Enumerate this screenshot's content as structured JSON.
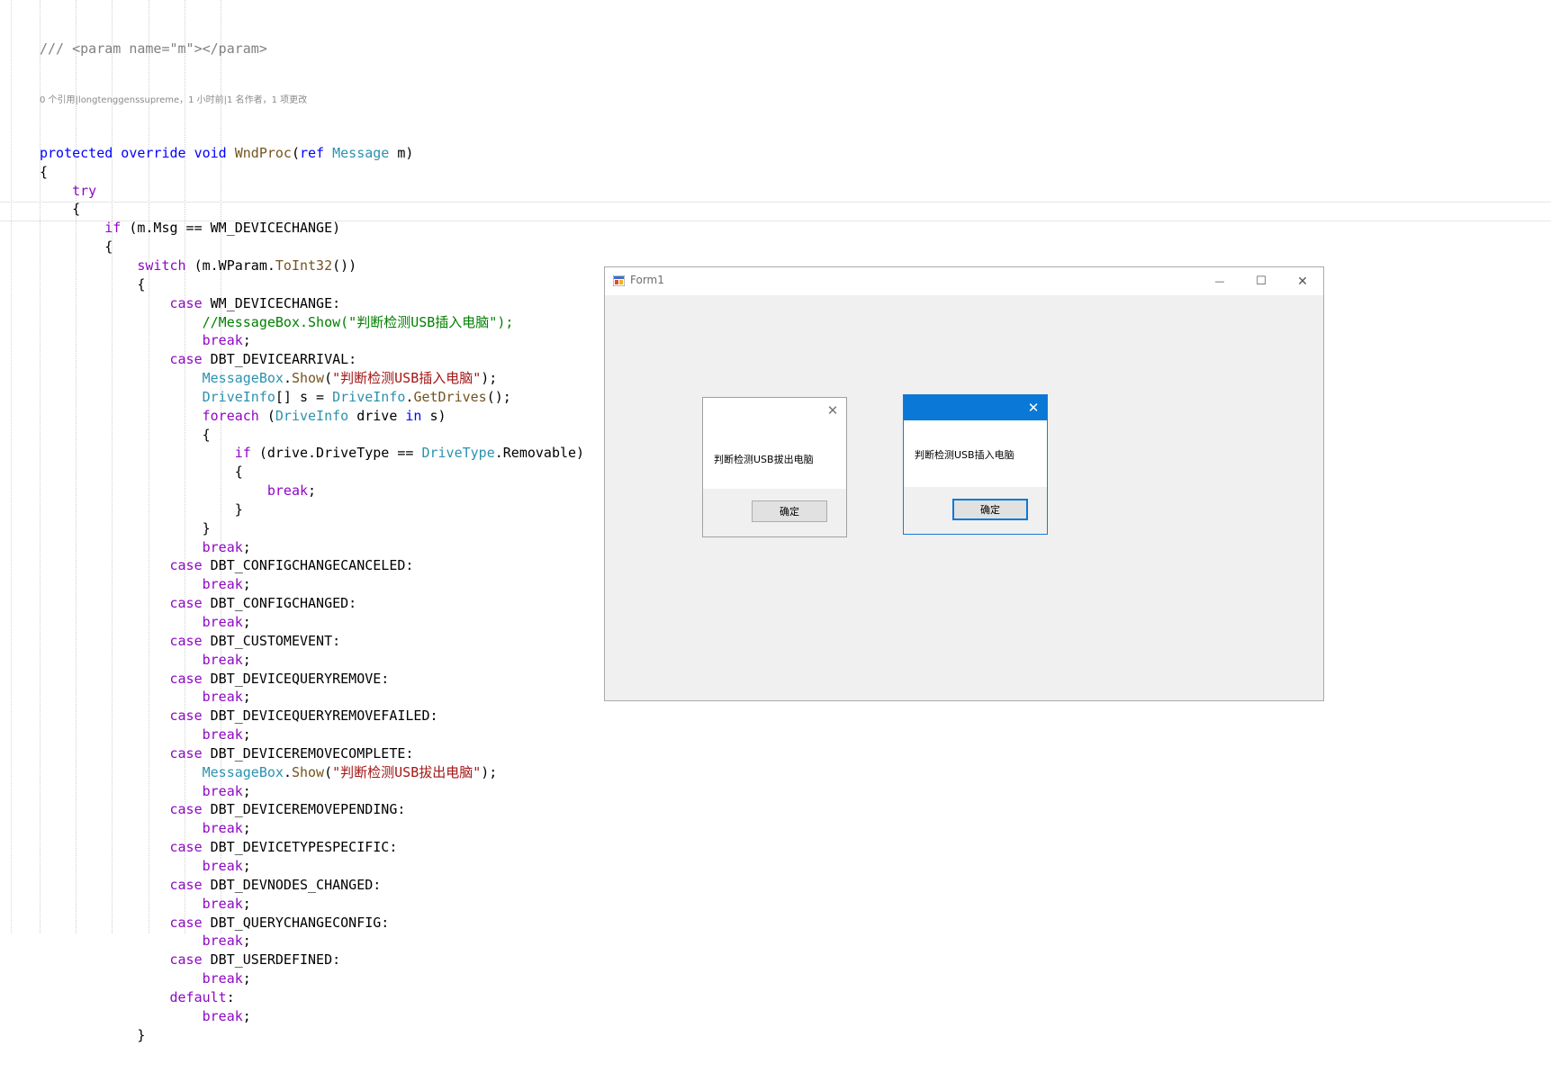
{
  "editor": {
    "codelens": "0 个引用|longtenggenssupreme，1 小时前|1 名作者，1 项更改",
    "lines": [
      [
        {
          "t": "/// <param name=\"m\"></param>",
          "c": "doc"
        }
      ],
      [
        {
          "t": "protected override void ",
          "c": "kw"
        },
        {
          "t": "WndProc",
          "c": "mt"
        },
        {
          "t": "(",
          "c": ""
        },
        {
          "t": "ref ",
          "c": "kw"
        },
        {
          "t": "Message",
          "c": "ty"
        },
        {
          "t": " m)",
          "c": ""
        }
      ],
      [
        {
          "t": "{",
          "c": ""
        }
      ],
      [
        {
          "t": "    ",
          "c": ""
        },
        {
          "t": "try",
          "c": "kwp"
        }
      ],
      [
        {
          "t": "    {",
          "c": ""
        }
      ],
      [
        {
          "t": "        ",
          "c": ""
        },
        {
          "t": "if",
          "c": "kwp"
        },
        {
          "t": " (m.Msg == WM_DEVICECHANGE)",
          "c": ""
        }
      ],
      [
        {
          "t": "        {",
          "c": ""
        }
      ],
      [
        {
          "t": "            ",
          "c": ""
        },
        {
          "t": "switch",
          "c": "kwp"
        },
        {
          "t": " (m.WParam.",
          "c": ""
        },
        {
          "t": "ToInt32",
          "c": "mt"
        },
        {
          "t": "())",
          "c": ""
        }
      ],
      [
        {
          "t": "            {",
          "c": ""
        }
      ],
      [
        {
          "t": "                ",
          "c": ""
        },
        {
          "t": "case",
          "c": "kwp"
        },
        {
          "t": " WM_DEVICECHANGE:",
          "c": ""
        }
      ],
      [
        {
          "t": "                    ",
          "c": ""
        },
        {
          "t": "//MessageBox.Show(\"判断检测USB插入电脑\");",
          "c": "cm"
        }
      ],
      [
        {
          "t": "                    ",
          "c": ""
        },
        {
          "t": "break",
          "c": "kwp"
        },
        {
          "t": ";",
          "c": ""
        }
      ],
      [
        {
          "t": "                ",
          "c": ""
        },
        {
          "t": "case",
          "c": "kwp"
        },
        {
          "t": " DBT_DEVICEARRIVAL:",
          "c": ""
        }
      ],
      [
        {
          "t": "                    ",
          "c": ""
        },
        {
          "t": "MessageBox",
          "c": "ty"
        },
        {
          "t": ".",
          "c": ""
        },
        {
          "t": "Show",
          "c": "mt"
        },
        {
          "t": "(",
          "c": ""
        },
        {
          "t": "\"判断检测USB插入电脑\"",
          "c": "str"
        },
        {
          "t": ");",
          "c": ""
        }
      ],
      [
        {
          "t": "                    ",
          "c": ""
        },
        {
          "t": "DriveInfo",
          "c": "ty"
        },
        {
          "t": "[] s = ",
          "c": ""
        },
        {
          "t": "DriveInfo",
          "c": "ty"
        },
        {
          "t": ".",
          "c": ""
        },
        {
          "t": "GetDrives",
          "c": "mt"
        },
        {
          "t": "();",
          "c": ""
        }
      ],
      [
        {
          "t": "                    ",
          "c": ""
        },
        {
          "t": "foreach",
          "c": "kwp"
        },
        {
          "t": " (",
          "c": ""
        },
        {
          "t": "DriveInfo",
          "c": "ty"
        },
        {
          "t": " drive ",
          "c": ""
        },
        {
          "t": "in",
          "c": "kw"
        },
        {
          "t": " s)",
          "c": ""
        }
      ],
      [
        {
          "t": "                    {",
          "c": ""
        }
      ],
      [
        {
          "t": "                        ",
          "c": ""
        },
        {
          "t": "if",
          "c": "kwp"
        },
        {
          "t": " (drive.DriveType == ",
          "c": ""
        },
        {
          "t": "DriveType",
          "c": "ty"
        },
        {
          "t": ".Removable)",
          "c": ""
        }
      ],
      [
        {
          "t": "                        {",
          "c": ""
        }
      ],
      [
        {
          "t": "                            ",
          "c": ""
        },
        {
          "t": "break",
          "c": "kwp"
        },
        {
          "t": ";",
          "c": ""
        }
      ],
      [
        {
          "t": "                        }",
          "c": ""
        }
      ],
      [
        {
          "t": "                    }",
          "c": ""
        }
      ],
      [
        {
          "t": "                    ",
          "c": ""
        },
        {
          "t": "break",
          "c": "kwp"
        },
        {
          "t": ";",
          "c": ""
        }
      ],
      [
        {
          "t": "                ",
          "c": ""
        },
        {
          "t": "case",
          "c": "kwp"
        },
        {
          "t": " DBT_CONFIGCHANGECANCELED:",
          "c": ""
        }
      ],
      [
        {
          "t": "                    ",
          "c": ""
        },
        {
          "t": "break",
          "c": "kwp"
        },
        {
          "t": ";",
          "c": ""
        }
      ],
      [
        {
          "t": "                ",
          "c": ""
        },
        {
          "t": "case",
          "c": "kwp"
        },
        {
          "t": " DBT_CONFIGCHANGED:",
          "c": ""
        }
      ],
      [
        {
          "t": "                    ",
          "c": ""
        },
        {
          "t": "break",
          "c": "kwp"
        },
        {
          "t": ";",
          "c": ""
        }
      ],
      [
        {
          "t": "                ",
          "c": ""
        },
        {
          "t": "case",
          "c": "kwp"
        },
        {
          "t": " DBT_CUSTOMEVENT:",
          "c": ""
        }
      ],
      [
        {
          "t": "                    ",
          "c": ""
        },
        {
          "t": "break",
          "c": "kwp"
        },
        {
          "t": ";",
          "c": ""
        }
      ],
      [
        {
          "t": "                ",
          "c": ""
        },
        {
          "t": "case",
          "c": "kwp"
        },
        {
          "t": " DBT_DEVICEQUERYREMOVE:",
          "c": ""
        }
      ],
      [
        {
          "t": "                    ",
          "c": ""
        },
        {
          "t": "break",
          "c": "kwp"
        },
        {
          "t": ";",
          "c": ""
        }
      ],
      [
        {
          "t": "                ",
          "c": ""
        },
        {
          "t": "case",
          "c": "kwp"
        },
        {
          "t": " DBT_DEVICEQUERYREMOVEFAILED:",
          "c": ""
        }
      ],
      [
        {
          "t": "                    ",
          "c": ""
        },
        {
          "t": "break",
          "c": "kwp"
        },
        {
          "t": ";",
          "c": ""
        }
      ],
      [
        {
          "t": "                ",
          "c": ""
        },
        {
          "t": "case",
          "c": "kwp"
        },
        {
          "t": " DBT_DEVICEREMOVECOMPLETE:",
          "c": ""
        }
      ],
      [
        {
          "t": "                    ",
          "c": ""
        },
        {
          "t": "MessageBox",
          "c": "ty"
        },
        {
          "t": ".",
          "c": ""
        },
        {
          "t": "Show",
          "c": "mt"
        },
        {
          "t": "(",
          "c": ""
        },
        {
          "t": "\"判断检测USB拔出电脑\"",
          "c": "str"
        },
        {
          "t": ");",
          "c": ""
        }
      ],
      [
        {
          "t": "                    ",
          "c": ""
        },
        {
          "t": "break",
          "c": "kwp"
        },
        {
          "t": ";",
          "c": ""
        }
      ],
      [
        {
          "t": "                ",
          "c": ""
        },
        {
          "t": "case",
          "c": "kwp"
        },
        {
          "t": " DBT_DEVICEREMOVEPENDING:",
          "c": ""
        }
      ],
      [
        {
          "t": "                    ",
          "c": ""
        },
        {
          "t": "break",
          "c": "kwp"
        },
        {
          "t": ";",
          "c": ""
        }
      ],
      [
        {
          "t": "                ",
          "c": ""
        },
        {
          "t": "case",
          "c": "kwp"
        },
        {
          "t": " DBT_DEVICETYPESPECIFIC:",
          "c": ""
        }
      ],
      [
        {
          "t": "                    ",
          "c": ""
        },
        {
          "t": "break",
          "c": "kwp"
        },
        {
          "t": ";",
          "c": ""
        }
      ],
      [
        {
          "t": "                ",
          "c": ""
        },
        {
          "t": "case",
          "c": "kwp"
        },
        {
          "t": " DBT_DEVNODES_CHANGED:",
          "c": ""
        }
      ],
      [
        {
          "t": "                    ",
          "c": ""
        },
        {
          "t": "break",
          "c": "kwp"
        },
        {
          "t": ";",
          "c": ""
        }
      ],
      [
        {
          "t": "                ",
          "c": ""
        },
        {
          "t": "case",
          "c": "kwp"
        },
        {
          "t": " DBT_QUERYCHANGECONFIG:",
          "c": ""
        }
      ],
      [
        {
          "t": "                    ",
          "c": ""
        },
        {
          "t": "break",
          "c": "kwp"
        },
        {
          "t": ";",
          "c": ""
        }
      ],
      [
        {
          "t": "                ",
          "c": ""
        },
        {
          "t": "case",
          "c": "kwp"
        },
        {
          "t": " DBT_USERDEFINED:",
          "c": ""
        }
      ],
      [
        {
          "t": "                    ",
          "c": ""
        },
        {
          "t": "break",
          "c": "kwp"
        },
        {
          "t": ";",
          "c": ""
        }
      ],
      [
        {
          "t": "                ",
          "c": ""
        },
        {
          "t": "default",
          "c": "kwp"
        },
        {
          "t": ":",
          "c": ""
        }
      ],
      [
        {
          "t": "                    ",
          "c": ""
        },
        {
          "t": "break",
          "c": "kwp"
        },
        {
          "t": ";",
          "c": ""
        }
      ],
      [
        {
          "t": "            }",
          "c": ""
        }
      ]
    ],
    "colors": {
      "keyword": "#0000ff",
      "control_keyword": "#8f08c4",
      "type": "#2b91af",
      "string": "#a31515",
      "comment": "#008000",
      "doc_comment": "#808080",
      "method": "#74531f"
    }
  },
  "form1": {
    "title": "Form1",
    "icon": "winforms-app-icon",
    "minimize_glyph": "—",
    "maximize_glyph": "☐",
    "close_glyph": "✕"
  },
  "msgbox_removed": {
    "text": "判断检测USB拔出电脑",
    "ok_label": "确定",
    "close_glyph": "✕",
    "active": false
  },
  "msgbox_inserted": {
    "text": "判断检测USB插入电脑",
    "ok_label": "确定",
    "close_glyph": "✕",
    "active": true,
    "accent": "#0a78d7"
  }
}
